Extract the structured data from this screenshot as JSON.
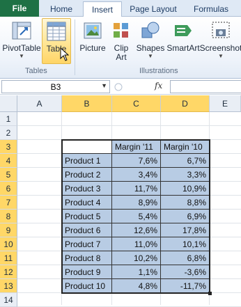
{
  "tabs": {
    "file": "File",
    "home": "Home",
    "insert": "Insert",
    "page_layout": "Page Layout",
    "formulas": "Formulas"
  },
  "ribbon": {
    "pivottable": "PivotTable",
    "table": "Table",
    "picture": "Picture",
    "clipart_line1": "Clip",
    "clipart_line2": "Art",
    "shapes": "Shapes",
    "smartart": "SmartArt",
    "screenshot": "Screenshot",
    "group_tables": "Tables",
    "group_illustrations": "Illustrations"
  },
  "formula_bar": {
    "name_box": "B3",
    "fx": "fx",
    "value": ""
  },
  "columns": [
    "A",
    "B",
    "C",
    "D",
    "E"
  ],
  "rows": [
    "1",
    "2",
    "3",
    "4",
    "5",
    "6",
    "7",
    "8",
    "9",
    "10",
    "11",
    "12",
    "13",
    "14"
  ],
  "table": {
    "headers": [
      "",
      "Margin '11",
      "Margin '10"
    ],
    "rows": [
      [
        "Product 1",
        "7,6%",
        "6,7%"
      ],
      [
        "Product 2",
        "3,4%",
        "3,3%"
      ],
      [
        "Product 3",
        "11,7%",
        "10,9%"
      ],
      [
        "Product 4",
        "8,9%",
        "8,8%"
      ],
      [
        "Product 5",
        "5,4%",
        "6,9%"
      ],
      [
        "Product 6",
        "12,6%",
        "17,8%"
      ],
      [
        "Product 7",
        "11,0%",
        "10,1%"
      ],
      [
        "Product 8",
        "10,2%",
        "6,8%"
      ],
      [
        "Product 9",
        "1,1%",
        "-3,6%"
      ],
      [
        "Product 10",
        "4,8%",
        "-11,7%"
      ]
    ]
  },
  "colors": {
    "file_tab": "#1e7145",
    "selection": "#b8cce4",
    "header_highlight": "#ffd767"
  }
}
